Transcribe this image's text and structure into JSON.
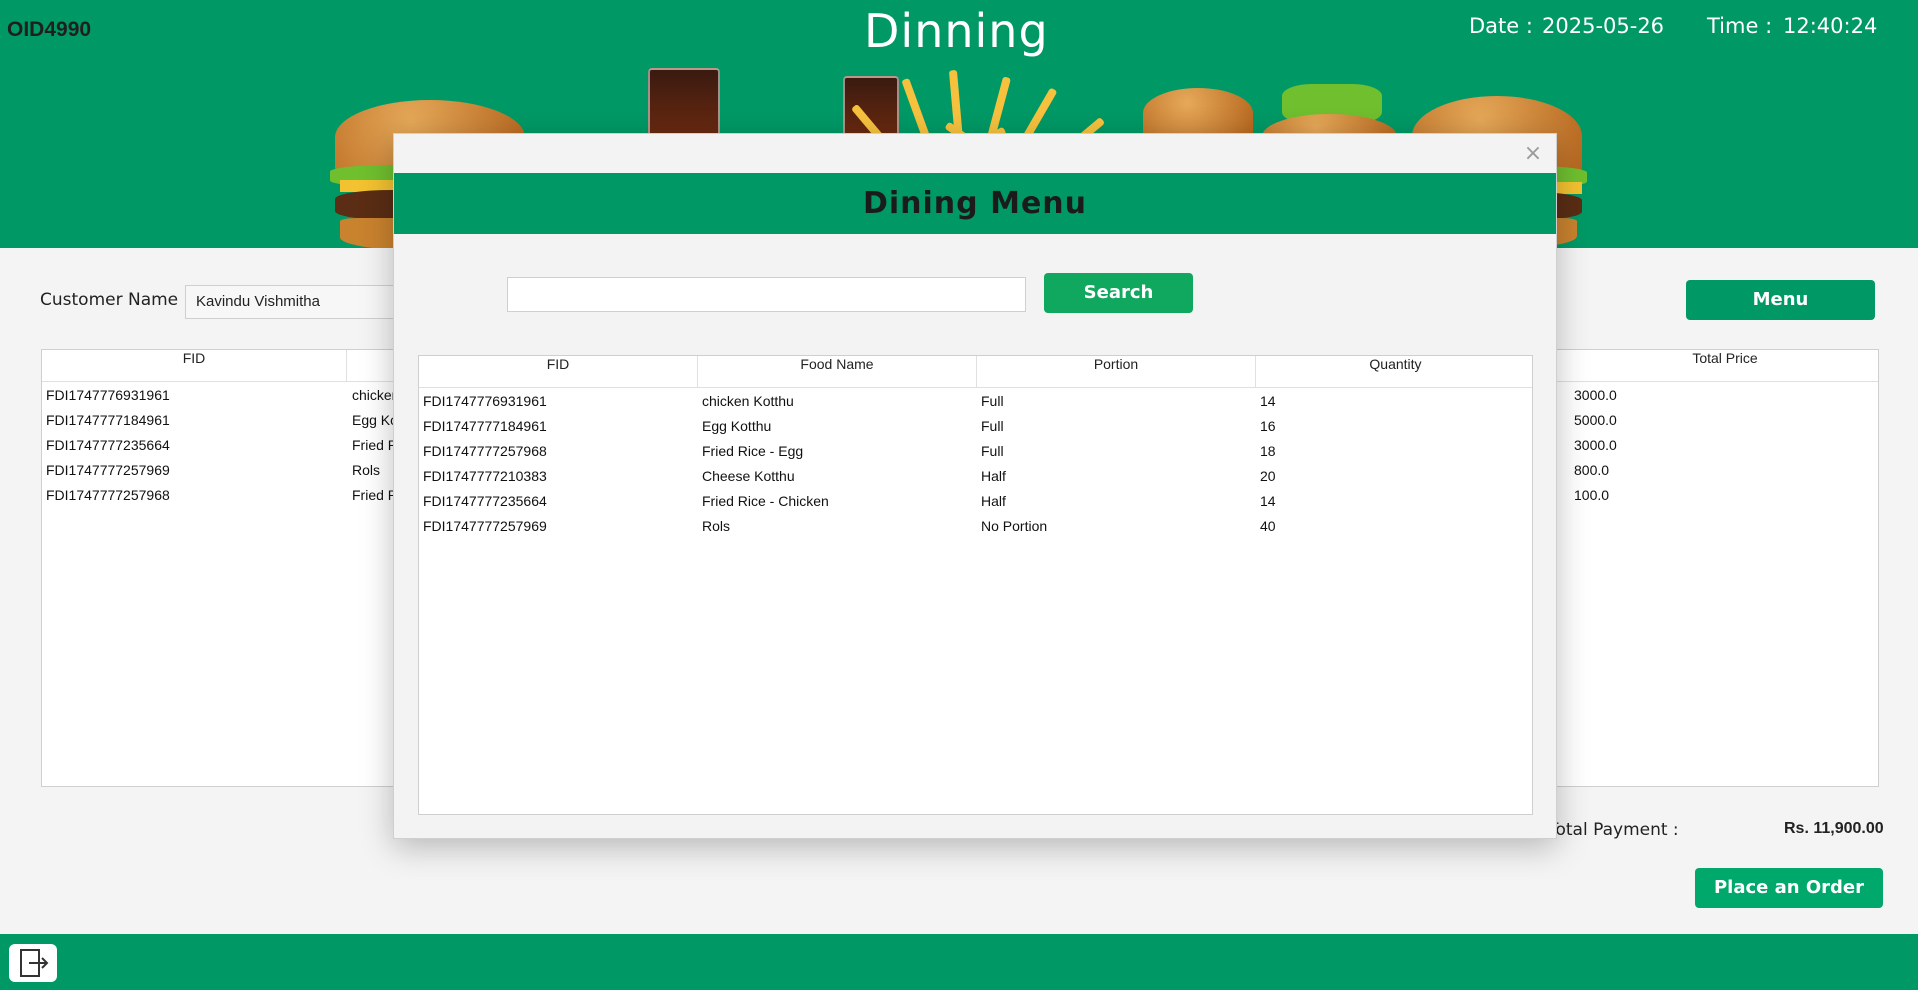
{
  "header": {
    "order_id": "OID4990",
    "title": "Dinning",
    "date_label": "Date :",
    "date_value": "2025-05-26",
    "time_label": "Time :",
    "time_value": "12:40:24"
  },
  "customer": {
    "label": "Customer Name",
    "value": "Kavindu Vishmitha"
  },
  "menu_button": "Menu",
  "order_table": {
    "columns": [
      "FID",
      "",
      "",
      "",
      "Total Price"
    ],
    "rows": [
      {
        "fid": "FDI1747776931961",
        "name": "chicken",
        "total": "3000.0"
      },
      {
        "fid": "FDI1747777184961",
        "name": "Egg Ko",
        "total": "5000.0"
      },
      {
        "fid": "FDI1747777235664",
        "name": "Fried R",
        "total": "3000.0"
      },
      {
        "fid": "FDI1747777257969",
        "name": "Rols",
        "total": "800.0"
      },
      {
        "fid": "FDI1747777257968",
        "name": "Fried R",
        "total": "100.0"
      }
    ]
  },
  "total_payment": {
    "label": "Total Payment :",
    "value": "Rs. 11,900.00"
  },
  "place_order_button": "Place an Order",
  "dialog": {
    "close_symbol": "×",
    "title": "Dining Menu",
    "search_value": "",
    "search_button": "Search",
    "columns": [
      "FID",
      "Food Name",
      "Portion",
      "Quantity"
    ],
    "rows": [
      [
        "FDI1747776931961",
        "chicken Kotthu",
        "Full",
        "14"
      ],
      [
        "FDI1747777184961",
        "Egg Kotthu",
        "Full",
        "16"
      ],
      [
        "FDI1747777257968",
        "Fried Rice - Egg",
        "Full",
        "18"
      ],
      [
        "FDI1747777210383",
        "Cheese Kotthu",
        "Half",
        "20"
      ],
      [
        "FDI1747777235664",
        "Fried Rice - Chicken",
        "Half",
        "14"
      ],
      [
        "FDI1747777257969",
        "Rols",
        "No Portion",
        "40"
      ]
    ]
  },
  "colors": {
    "brand_green": "#009966",
    "button_green": "#0fa85e"
  }
}
